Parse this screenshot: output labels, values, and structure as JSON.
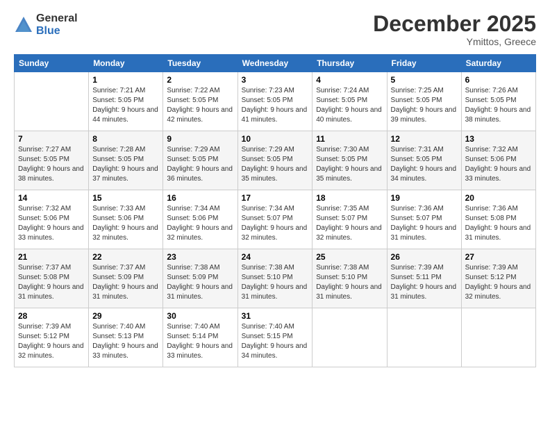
{
  "logo": {
    "general": "General",
    "blue": "Blue"
  },
  "header": {
    "title": "December 2025",
    "subtitle": "Ymittos, Greece"
  },
  "weekdays": [
    "Sunday",
    "Monday",
    "Tuesday",
    "Wednesday",
    "Thursday",
    "Friday",
    "Saturday"
  ],
  "weeks": [
    [
      {
        "num": "",
        "sunrise": "",
        "sunset": "",
        "daylight": ""
      },
      {
        "num": "1",
        "sunrise": "Sunrise: 7:21 AM",
        "sunset": "Sunset: 5:05 PM",
        "daylight": "Daylight: 9 hours and 44 minutes."
      },
      {
        "num": "2",
        "sunrise": "Sunrise: 7:22 AM",
        "sunset": "Sunset: 5:05 PM",
        "daylight": "Daylight: 9 hours and 42 minutes."
      },
      {
        "num": "3",
        "sunrise": "Sunrise: 7:23 AM",
        "sunset": "Sunset: 5:05 PM",
        "daylight": "Daylight: 9 hours and 41 minutes."
      },
      {
        "num": "4",
        "sunrise": "Sunrise: 7:24 AM",
        "sunset": "Sunset: 5:05 PM",
        "daylight": "Daylight: 9 hours and 40 minutes."
      },
      {
        "num": "5",
        "sunrise": "Sunrise: 7:25 AM",
        "sunset": "Sunset: 5:05 PM",
        "daylight": "Daylight: 9 hours and 39 minutes."
      },
      {
        "num": "6",
        "sunrise": "Sunrise: 7:26 AM",
        "sunset": "Sunset: 5:05 PM",
        "daylight": "Daylight: 9 hours and 38 minutes."
      }
    ],
    [
      {
        "num": "7",
        "sunrise": "Sunrise: 7:27 AM",
        "sunset": "Sunset: 5:05 PM",
        "daylight": "Daylight: 9 hours and 38 minutes."
      },
      {
        "num": "8",
        "sunrise": "Sunrise: 7:28 AM",
        "sunset": "Sunset: 5:05 PM",
        "daylight": "Daylight: 9 hours and 37 minutes."
      },
      {
        "num": "9",
        "sunrise": "Sunrise: 7:29 AM",
        "sunset": "Sunset: 5:05 PM",
        "daylight": "Daylight: 9 hours and 36 minutes."
      },
      {
        "num": "10",
        "sunrise": "Sunrise: 7:29 AM",
        "sunset": "Sunset: 5:05 PM",
        "daylight": "Daylight: 9 hours and 35 minutes."
      },
      {
        "num": "11",
        "sunrise": "Sunrise: 7:30 AM",
        "sunset": "Sunset: 5:05 PM",
        "daylight": "Daylight: 9 hours and 35 minutes."
      },
      {
        "num": "12",
        "sunrise": "Sunrise: 7:31 AM",
        "sunset": "Sunset: 5:05 PM",
        "daylight": "Daylight: 9 hours and 34 minutes."
      },
      {
        "num": "13",
        "sunrise": "Sunrise: 7:32 AM",
        "sunset": "Sunset: 5:06 PM",
        "daylight": "Daylight: 9 hours and 33 minutes."
      }
    ],
    [
      {
        "num": "14",
        "sunrise": "Sunrise: 7:32 AM",
        "sunset": "Sunset: 5:06 PM",
        "daylight": "Daylight: 9 hours and 33 minutes."
      },
      {
        "num": "15",
        "sunrise": "Sunrise: 7:33 AM",
        "sunset": "Sunset: 5:06 PM",
        "daylight": "Daylight: 9 hours and 32 minutes."
      },
      {
        "num": "16",
        "sunrise": "Sunrise: 7:34 AM",
        "sunset": "Sunset: 5:06 PM",
        "daylight": "Daylight: 9 hours and 32 minutes."
      },
      {
        "num": "17",
        "sunrise": "Sunrise: 7:34 AM",
        "sunset": "Sunset: 5:07 PM",
        "daylight": "Daylight: 9 hours and 32 minutes."
      },
      {
        "num": "18",
        "sunrise": "Sunrise: 7:35 AM",
        "sunset": "Sunset: 5:07 PM",
        "daylight": "Daylight: 9 hours and 32 minutes."
      },
      {
        "num": "19",
        "sunrise": "Sunrise: 7:36 AM",
        "sunset": "Sunset: 5:07 PM",
        "daylight": "Daylight: 9 hours and 31 minutes."
      },
      {
        "num": "20",
        "sunrise": "Sunrise: 7:36 AM",
        "sunset": "Sunset: 5:08 PM",
        "daylight": "Daylight: 9 hours and 31 minutes."
      }
    ],
    [
      {
        "num": "21",
        "sunrise": "Sunrise: 7:37 AM",
        "sunset": "Sunset: 5:08 PM",
        "daylight": "Daylight: 9 hours and 31 minutes."
      },
      {
        "num": "22",
        "sunrise": "Sunrise: 7:37 AM",
        "sunset": "Sunset: 5:09 PM",
        "daylight": "Daylight: 9 hours and 31 minutes."
      },
      {
        "num": "23",
        "sunrise": "Sunrise: 7:38 AM",
        "sunset": "Sunset: 5:09 PM",
        "daylight": "Daylight: 9 hours and 31 minutes."
      },
      {
        "num": "24",
        "sunrise": "Sunrise: 7:38 AM",
        "sunset": "Sunset: 5:10 PM",
        "daylight": "Daylight: 9 hours and 31 minutes."
      },
      {
        "num": "25",
        "sunrise": "Sunrise: 7:38 AM",
        "sunset": "Sunset: 5:10 PM",
        "daylight": "Daylight: 9 hours and 31 minutes."
      },
      {
        "num": "26",
        "sunrise": "Sunrise: 7:39 AM",
        "sunset": "Sunset: 5:11 PM",
        "daylight": "Daylight: 9 hours and 31 minutes."
      },
      {
        "num": "27",
        "sunrise": "Sunrise: 7:39 AM",
        "sunset": "Sunset: 5:12 PM",
        "daylight": "Daylight: 9 hours and 32 minutes."
      }
    ],
    [
      {
        "num": "28",
        "sunrise": "Sunrise: 7:39 AM",
        "sunset": "Sunset: 5:12 PM",
        "daylight": "Daylight: 9 hours and 32 minutes."
      },
      {
        "num": "29",
        "sunrise": "Sunrise: 7:40 AM",
        "sunset": "Sunset: 5:13 PM",
        "daylight": "Daylight: 9 hours and 33 minutes."
      },
      {
        "num": "30",
        "sunrise": "Sunrise: 7:40 AM",
        "sunset": "Sunset: 5:14 PM",
        "daylight": "Daylight: 9 hours and 33 minutes."
      },
      {
        "num": "31",
        "sunrise": "Sunrise: 7:40 AM",
        "sunset": "Sunset: 5:15 PM",
        "daylight": "Daylight: 9 hours and 34 minutes."
      },
      {
        "num": "",
        "sunrise": "",
        "sunset": "",
        "daylight": ""
      },
      {
        "num": "",
        "sunrise": "",
        "sunset": "",
        "daylight": ""
      },
      {
        "num": "",
        "sunrise": "",
        "sunset": "",
        "daylight": ""
      }
    ]
  ]
}
